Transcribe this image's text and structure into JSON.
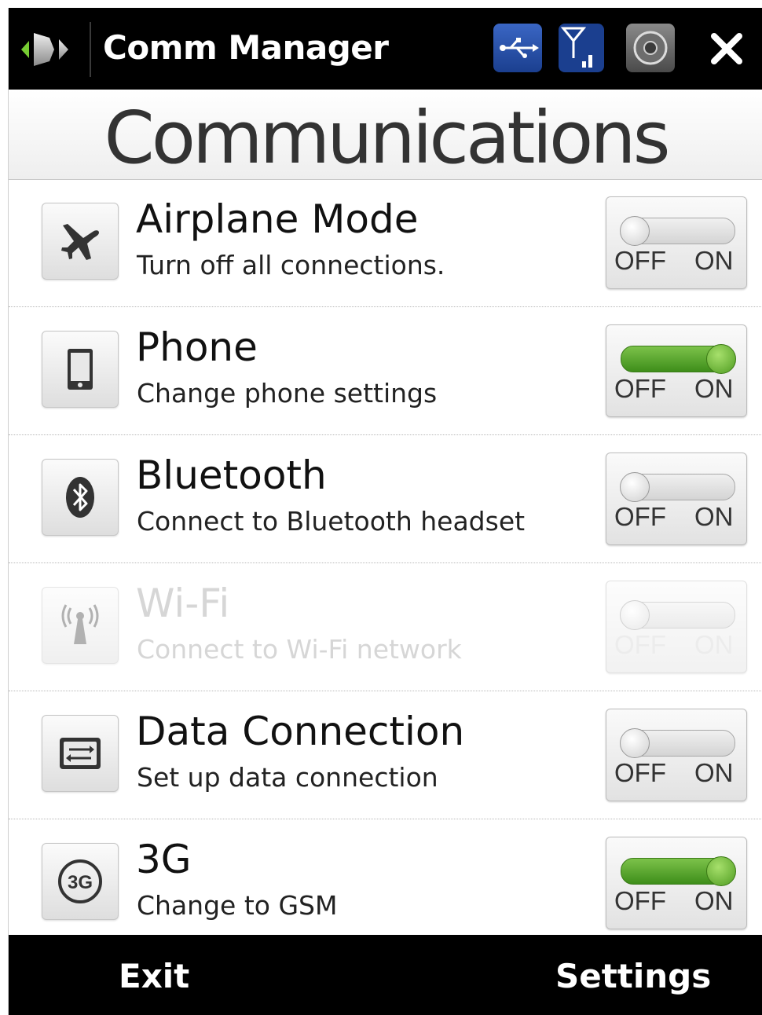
{
  "titlebar": {
    "title": "Comm Manager",
    "icons": [
      "start-icon",
      "usb-icon",
      "signal-icon",
      "speaker-icon",
      "close-icon"
    ]
  },
  "header": {
    "title": "Communications"
  },
  "rows": [
    {
      "label": "Airplane Mode",
      "description": "Turn off all connections.",
      "icon": "airplane-icon",
      "state": "off",
      "enabled": true,
      "off_label": "OFF",
      "on_label": "ON"
    },
    {
      "label": "Phone",
      "description": "Change phone settings",
      "icon": "phone-icon",
      "state": "on",
      "enabled": true,
      "off_label": "OFF",
      "on_label": "ON"
    },
    {
      "label": "Bluetooth",
      "description": "Connect to Bluetooth headset",
      "icon": "bluetooth-icon",
      "state": "off",
      "enabled": true,
      "off_label": "OFF",
      "on_label": "ON"
    },
    {
      "label": "Wi-Fi",
      "description": "Connect to Wi-Fi network",
      "icon": "wifi-icon",
      "state": "off",
      "enabled": false,
      "off_label": "OFF",
      "on_label": "ON"
    },
    {
      "label": "Data Connection",
      "description": "Set up data connection",
      "icon": "data-connection-icon",
      "state": "off",
      "enabled": true,
      "off_label": "OFF",
      "on_label": "ON"
    },
    {
      "label": "3G",
      "description": "Change to GSM",
      "icon": "3g-icon",
      "state": "on",
      "enabled": true,
      "off_label": "OFF",
      "on_label": "ON"
    }
  ],
  "bottombar": {
    "left": "Exit",
    "right": "Settings"
  },
  "colors": {
    "toggle_on": "#4f9c21",
    "bar": "#000000"
  }
}
